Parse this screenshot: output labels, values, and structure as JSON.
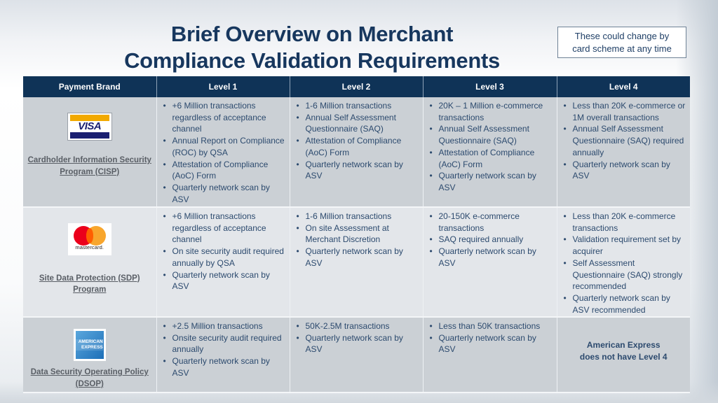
{
  "slide": {
    "title_lines": [
      "Brief Overview on Merchant",
      "Compliance Validation Requirements"
    ],
    "note_lines": [
      "These could change by",
      "card scheme at any time"
    ],
    "colors": {
      "header_bg": "#0f3357",
      "title": "#17375e",
      "row_dark": "#cbd0d5",
      "row_light": "#e3e6ea"
    }
  },
  "table": {
    "headers": [
      "Payment Brand",
      "Level 1",
      "Level 2",
      "Level 3",
      "Level 4"
    ],
    "rows": [
      {
        "brand_logo": "visa-logo",
        "logo_text": "VISA",
        "brand_program": "Cardholder Information Security Program (CISP)",
        "levels": [
          [
            "+6 Million transactions regardless of acceptance channel",
            "Annual Report on Compliance (ROC) by QSA",
            "Attestation of Compliance (AoC) Form",
            "Quarterly network scan by ASV"
          ],
          [
            "1-6 Million transactions",
            "Annual Self Assessment Questionnaire (SAQ)",
            "Attestation of Compliance (AoC) Form",
            "Quarterly network scan by ASV"
          ],
          [
            "20K – 1 Million e-commerce transactions",
            "Annual Self Assessment Questionnaire (SAQ)",
            "Attestation of Compliance (AoC) Form",
            "Quarterly network scan by ASV"
          ],
          [
            "Less than 20K e-commerce or 1M overall transactions",
            "Annual Self Assessment Questionnaire (SAQ) required annually",
            "Quarterly network scan by ASV"
          ]
        ]
      },
      {
        "brand_logo": "mastercard-logo",
        "logo_text": "mastercard.",
        "brand_program": "Site Data Protection (SDP) Program",
        "levels": [
          [
            "+6 Million transactions regardless of acceptance channel",
            "On site security audit required annually by QSA",
            "Quarterly network scan by ASV"
          ],
          [
            "1-6 Million transactions",
            "On site Assessment at Merchant Discretion",
            "Quarterly network scan by ASV"
          ],
          [
            "20-150K e-commerce transactions",
            "SAQ required annually",
            "Quarterly network scan by ASV"
          ],
          [
            "Less than 20K e-commerce transactions",
            "Validation requirement set by acquirer",
            "Self Assessment Questionnaire (SAQ) strongly recommended",
            "Quarterly network scan by ASV recommended"
          ]
        ]
      },
      {
        "brand_logo": "american-express-logo",
        "logo_text": [
          "AMERICAN",
          "EXPRESS"
        ],
        "brand_program": "Data Security Operating Policy (DSOP)",
        "levels": [
          [
            "+2.5 Million transactions",
            "Onsite security audit required annually",
            "Quarterly network scan by ASV"
          ],
          [
            "50K-2.5M transactions",
            "Quarterly network scan by ASV"
          ],
          [
            "Less than 50K transactions",
            "Quarterly network scan by ASV"
          ]
        ],
        "level4_note_lines": [
          "American Express",
          "does not have Level 4"
        ]
      }
    ]
  }
}
